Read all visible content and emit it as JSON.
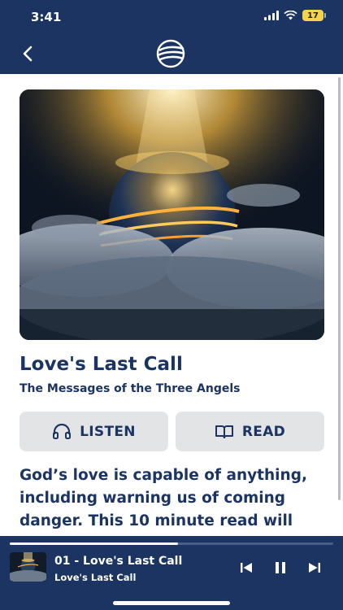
{
  "status": {
    "time": "3:41",
    "battery": "17"
  },
  "header": {
    "back_icon": "chevron-left-icon",
    "logo_icon": "globe-logo-icon"
  },
  "content": {
    "title": "Love's Last Call",
    "subtitle": "The Messages of the Three Angels",
    "listen_label": "LISTEN",
    "read_label": "READ",
    "body": "God’s love is capable of anything, including warning us of coming danger. This 10 minute read will"
  },
  "player": {
    "track_title": "01 - Love's Last Call",
    "track_subtitle": "Love's Last Call",
    "progress": 0.52
  },
  "colors": {
    "brand": "#1b3461",
    "button_bg": "#e3e4e6",
    "battery": "#f2d34a"
  }
}
